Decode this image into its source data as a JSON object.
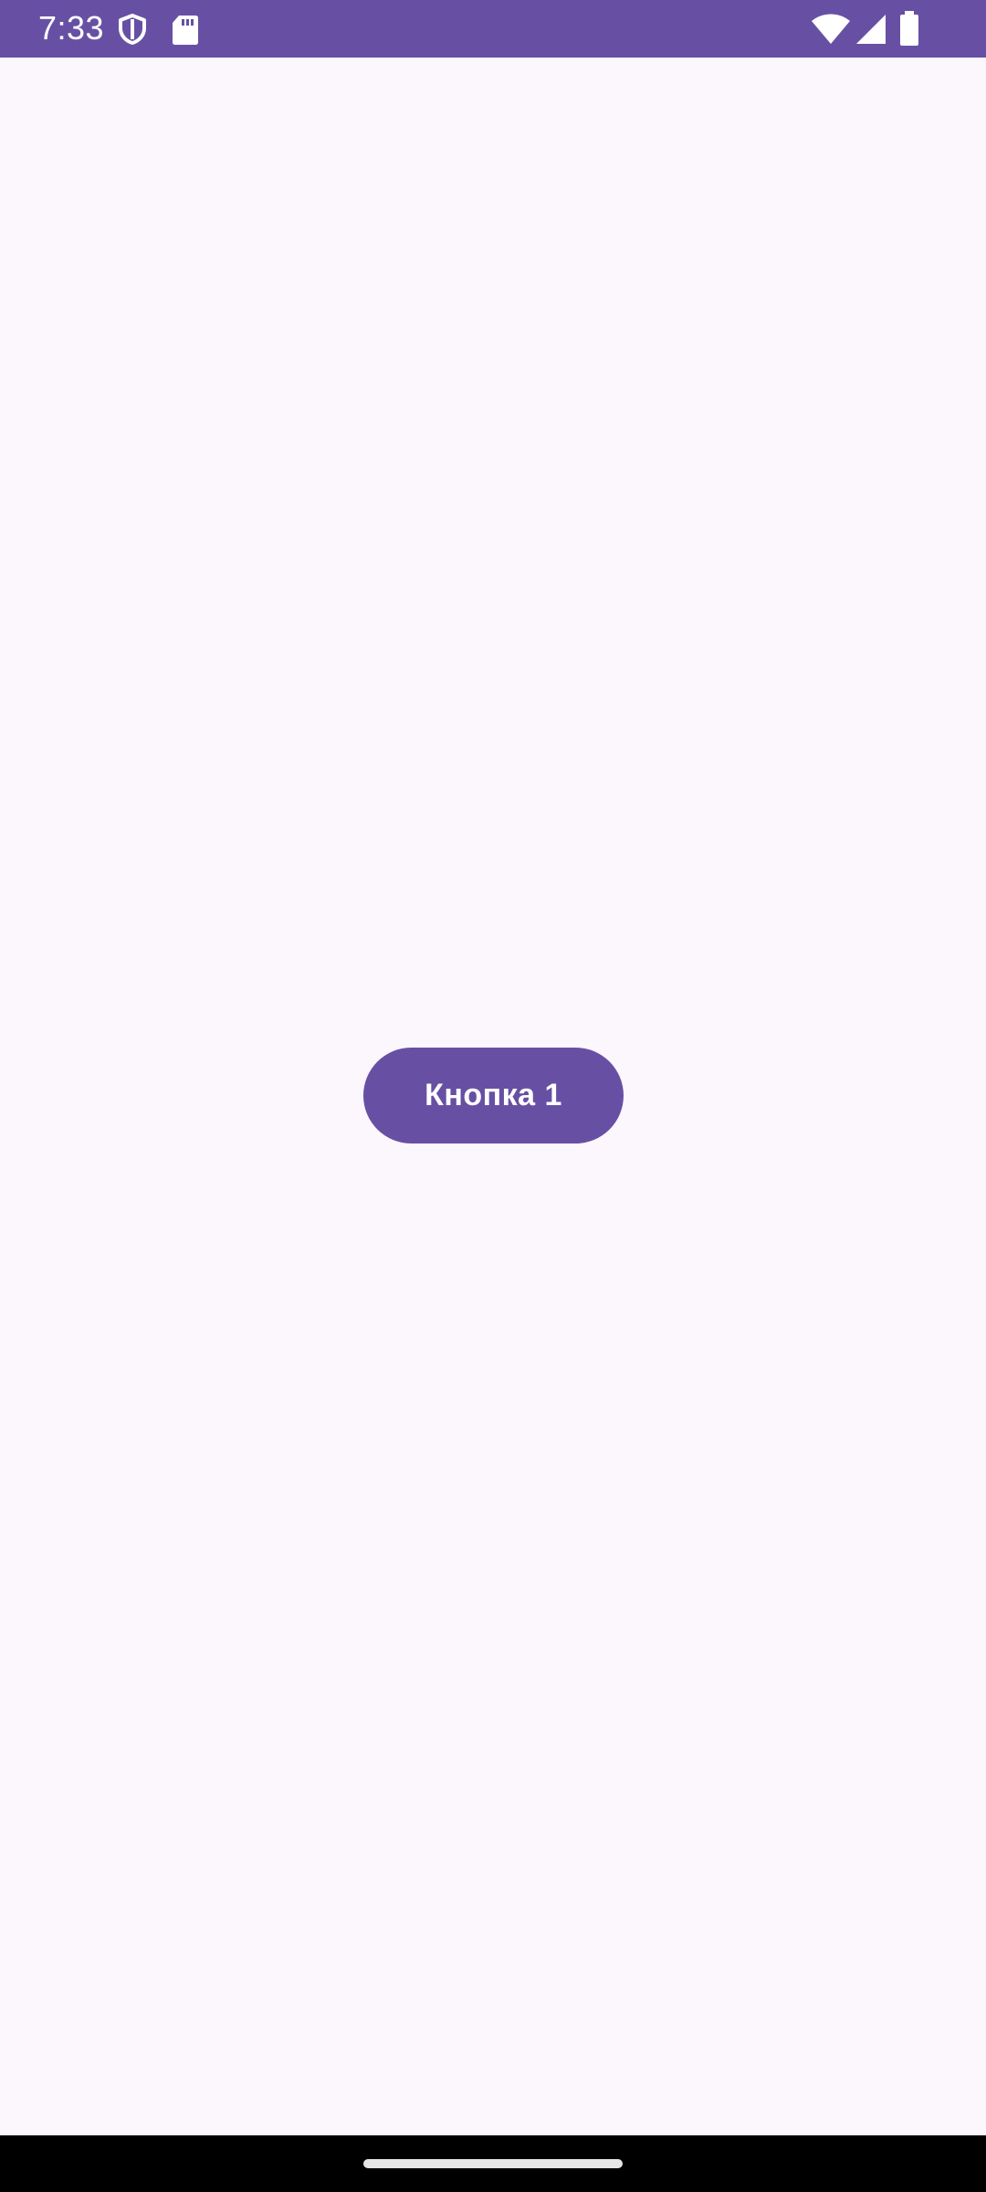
{
  "status_bar": {
    "time": "7:33",
    "icons": [
      "shield-icon",
      "sd-card-icon",
      "wifi-icon",
      "signal-icon",
      "battery-icon"
    ],
    "background_color": "#6750a4"
  },
  "main": {
    "button_label": "Кнопка 1",
    "button_color": "#6750a4",
    "background_color": "#fcf6fd"
  },
  "navigation_bar": {
    "handle": "home-gesture-handle",
    "background_color": "#000000"
  }
}
